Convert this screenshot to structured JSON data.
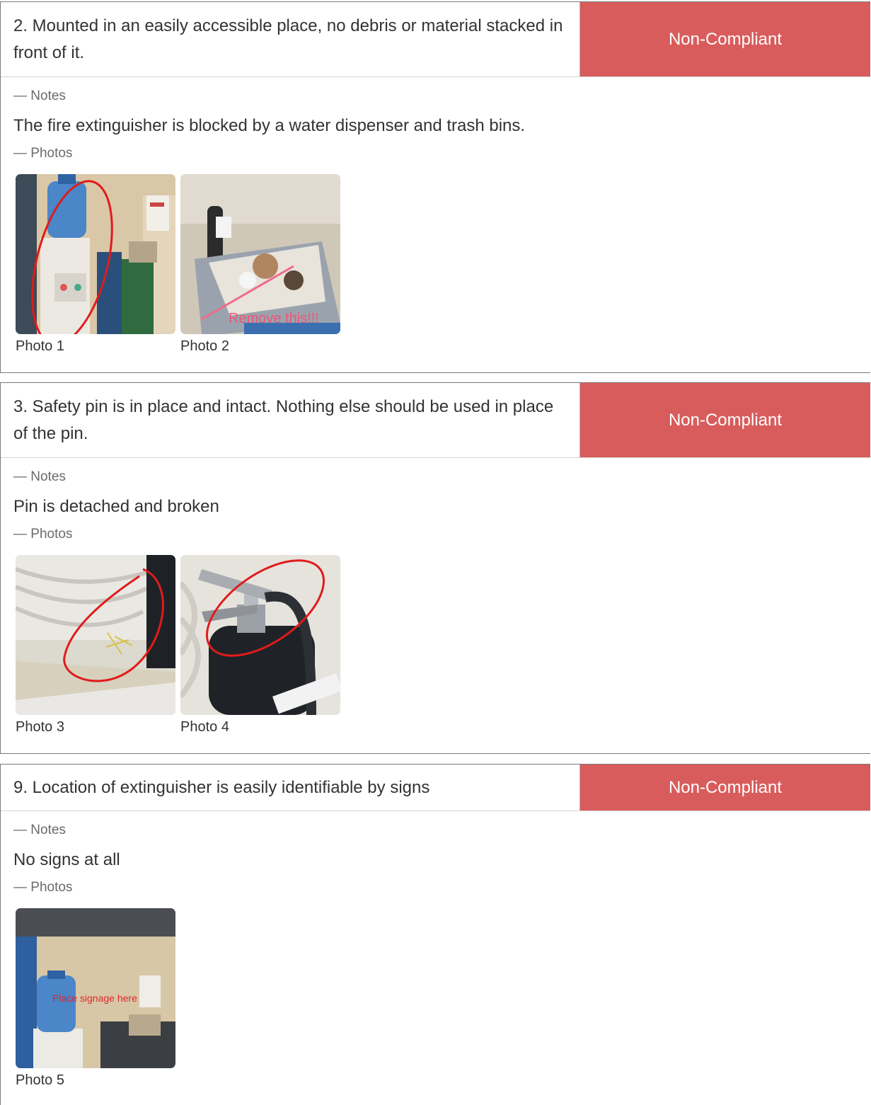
{
  "status_color": "#d95c5c",
  "items": [
    {
      "question": "2. Mounted in an easily accessible place, no debris or material stacked in front of it.",
      "status": "Non-Compliant",
      "notes_label": "— Notes",
      "note": "The fire extinguisher is blocked by a water dispenser and trash bins.",
      "photos_label": "— Photos",
      "photos": [
        {
          "caption": "Photo 1"
        },
        {
          "caption": "Photo 2",
          "overlay_text": "Remove this!!!"
        }
      ]
    },
    {
      "question": "3. Safety pin is in place and intact. Nothing else should be used in place of the pin.",
      "status": "Non-Compliant",
      "notes_label": "— Notes",
      "note": "Pin is detached and broken",
      "photos_label": "— Photos",
      "photos": [
        {
          "caption": "Photo 3"
        },
        {
          "caption": "Photo 4"
        }
      ]
    },
    {
      "question": "9. Location of extinguisher is easily identifiable by signs",
      "status": "Non-Compliant",
      "notes_label": "— Notes",
      "note": "No signs at all",
      "photos_label": "— Photos",
      "photos": [
        {
          "caption": "Photo 5",
          "overlay_text": "Place signage here"
        }
      ]
    }
  ]
}
